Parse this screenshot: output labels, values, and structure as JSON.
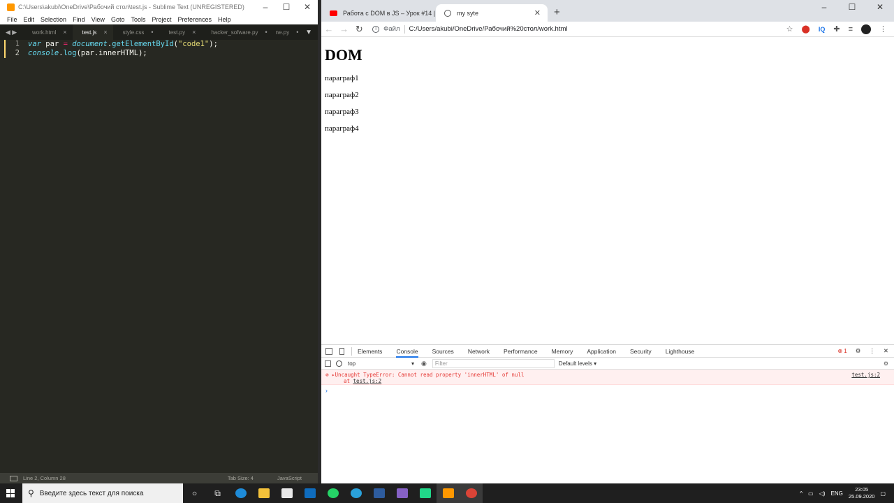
{
  "sublime": {
    "title": "C:\\Users\\akubi\\OneDrive\\Рабочий стол\\test.js - Sublime Text (UNREGISTERED)",
    "menu": [
      "File",
      "Edit",
      "Selection",
      "Find",
      "View",
      "Goto",
      "Tools",
      "Project",
      "Preferences",
      "Help"
    ],
    "tabs": [
      {
        "label": "work.html",
        "close": "×"
      },
      {
        "label": "test.js",
        "close": "×"
      },
      {
        "label": "style.css",
        "close": "•"
      },
      {
        "label": "test.py",
        "close": "×"
      },
      {
        "label": "hacker_sofware.py",
        "close": "•"
      },
      {
        "label": "ne.py",
        "close": "•"
      }
    ],
    "code": {
      "line1_num": "1",
      "line2_num": "2",
      "l1_var": "var",
      "l1_name": " par ",
      "l1_eq": "=",
      "l1_obj": " document",
      "l1_dot": ".",
      "l1_fn": "getElementById",
      "l1_open": "(",
      "l1_str": "\"code1\"",
      "l1_close": ");",
      "l2_obj": "console",
      "l2_dot": ".",
      "l2_fn": "log",
      "l2_rest": "(par.innerHTML);"
    },
    "status": {
      "position": "Line 2, Column 28",
      "tab_size": "Tab Size: 4",
      "syntax": "JavaScript"
    }
  },
  "chrome": {
    "tabs": [
      {
        "label": "Работа с DOM в JS – Урок #14 |",
        "icon": "youtube-icon"
      },
      {
        "label": "my syte",
        "icon": "globe-icon"
      }
    ],
    "new_tab": "+",
    "omnibox": {
      "scheme": "Файл",
      "url": "C:/Users/akubi/OneDrive/Рабочий%20стол/work.html"
    },
    "ext_iq": "IQ",
    "page": {
      "heading": "DOM",
      "paragraphs": [
        "параграф1",
        "параграф2",
        "параграф3",
        "параграф4"
      ]
    },
    "devtools": {
      "tabs": [
        "Elements",
        "Console",
        "Sources",
        "Network",
        "Performance",
        "Memory",
        "Application",
        "Security",
        "Lighthouse"
      ],
      "error_count": "1",
      "context": "top",
      "filter_placeholder": "Filter",
      "levels": "Default levels ▾",
      "error_line1": "▸Uncaught TypeError: Cannot read property 'innerHTML' of null",
      "error_line2_prefix": "at ",
      "error_link": "test.js:2",
      "error_source": "test.js:2",
      "prompt": "›"
    }
  },
  "taskbar": {
    "search_placeholder": "Введите здесь текст для поиска",
    "lang": "ENG",
    "time": "23:05",
    "date": "25.09.2020"
  },
  "colors": {
    "editor_bg": "#272822",
    "keyword": "#66d9ef",
    "operator": "#f92672",
    "string": "#e6db74",
    "error_red": "#e53935",
    "accent_blue": "#1a73e8"
  }
}
